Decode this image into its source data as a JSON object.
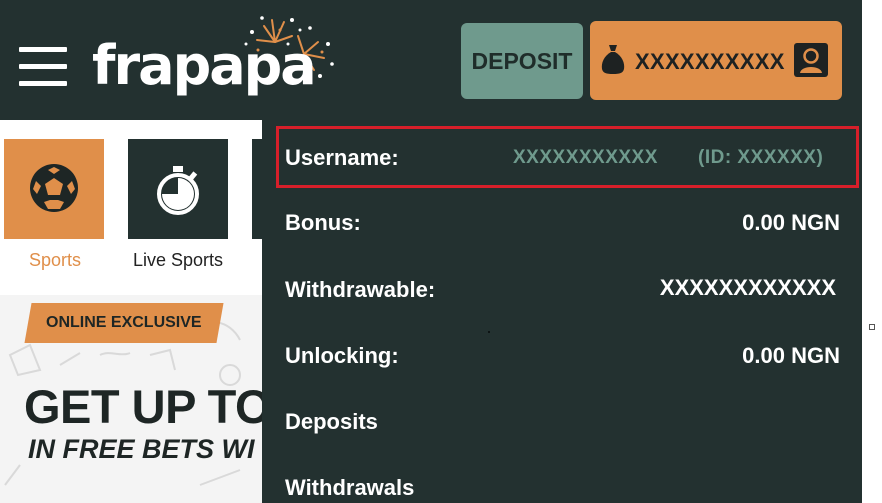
{
  "header": {
    "logo_text": "frapapa",
    "deposit_label": "DEPOSIT",
    "account_name": "XXXXXXXXXX"
  },
  "categories": [
    {
      "label": "Sports",
      "icon": "soccer-ball-icon",
      "active": true
    },
    {
      "label": "Live Sports",
      "icon": "stopwatch-icon",
      "active": false
    }
  ],
  "promo": {
    "badge": "ONLINE EXCLUSIVE",
    "title": "GET UP TO",
    "subtitle": "IN FREE BETS WI"
  },
  "account_menu": {
    "username_label": "Username:",
    "username_value": "XXXXXXXXXXX",
    "user_id": "(ID: XXXXXX)",
    "bonus_label": "Bonus:",
    "bonus_value": "0.00 NGN",
    "withdrawable_label": "Withdrawable:",
    "withdrawable_value": "XXXXXXXXXXXX",
    "unlocking_label": "Unlocking:",
    "unlocking_value": "0.00 NGN",
    "deposits_label": "Deposits",
    "withdrawals_label": "Withdrawals"
  },
  "colors": {
    "header_bg": "#233130",
    "accent_orange": "#e08f4a",
    "accent_green": "#6f9a8d",
    "highlight_red": "#d71f2a"
  }
}
